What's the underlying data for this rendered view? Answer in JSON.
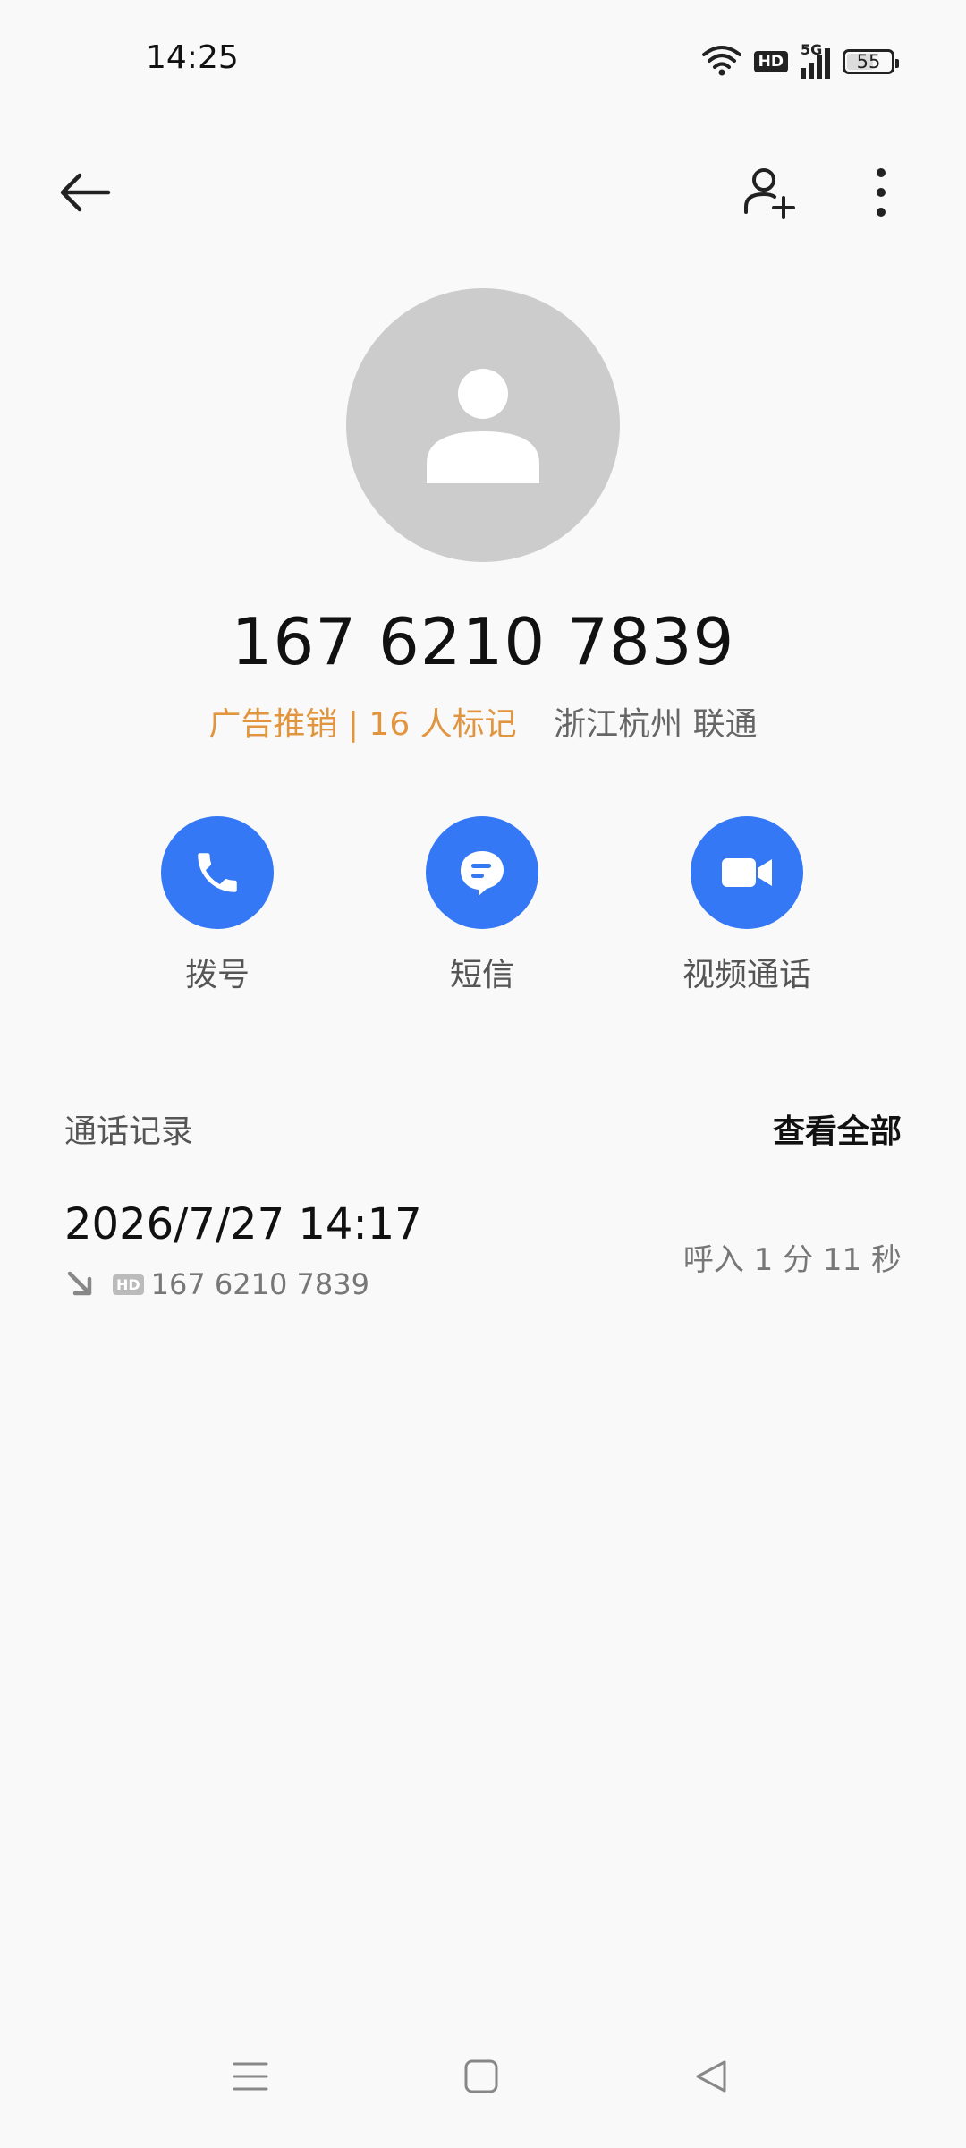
{
  "status_bar": {
    "time": "14:25",
    "network": "5G",
    "hd": "HD",
    "battery": "55",
    "icons": [
      "wifi-icon",
      "hd-icon",
      "signal-5g-icon",
      "battery-icon"
    ]
  },
  "top_bar": {
    "icons": [
      "back-arrow-icon",
      "add-contact-icon",
      "more-vertical-icon"
    ]
  },
  "contact": {
    "avatar_icon": "person-icon",
    "number": "167 6210 7839",
    "spam_tag": "广告推销 | 16 人标记",
    "location": "浙江杭州 联通"
  },
  "actions": [
    {
      "label": "拨号",
      "icon": "phone-icon"
    },
    {
      "label": "短信",
      "icon": "message-icon"
    },
    {
      "label": "视频通话",
      "icon": "video-icon"
    }
  ],
  "call_log": {
    "title": "通话记录",
    "view_all": "查看全部",
    "entries": [
      {
        "datetime": "2026/7/27 14:17",
        "direction_icon": "incoming-call-icon",
        "hd": "HD",
        "number": "167 6210 7839",
        "info": "呼入  1 分 11 秒"
      }
    ]
  },
  "colors": {
    "accent": "#3478f6",
    "spam": "#e2953f",
    "avatar_bg": "#cccccc",
    "background": "#f9f9f9"
  },
  "nav_bar": {
    "icons": [
      "menu-icon",
      "home-icon",
      "back-triangle-icon"
    ]
  }
}
